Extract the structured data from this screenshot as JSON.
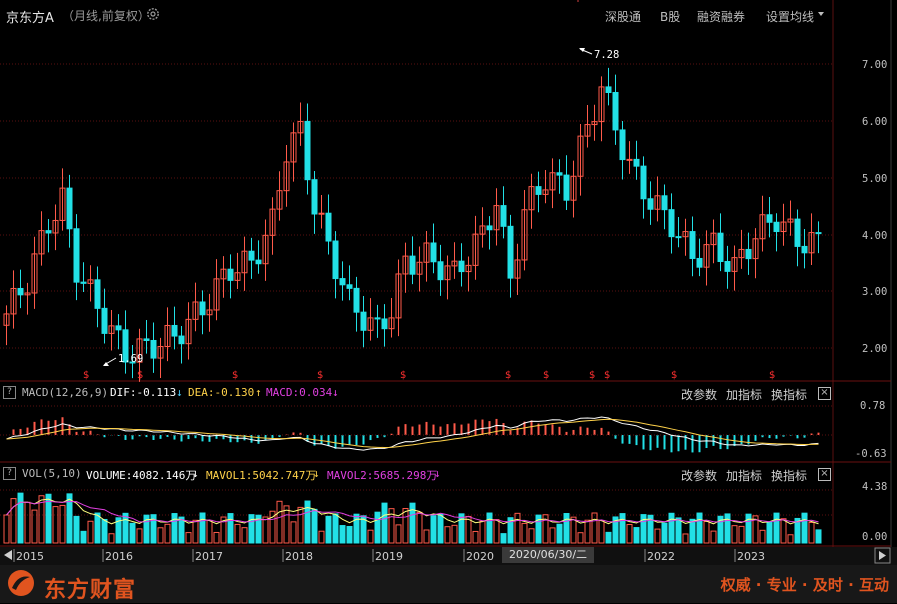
{
  "header": {
    "stock_name": "京东方A",
    "period_label": "（月线,前复权）",
    "nav": [
      "深股通",
      "B股",
      "融资融券",
      "设置均线"
    ]
  },
  "price_axis": [
    "7.00",
    "6.00",
    "5.00",
    "4.00",
    "3.00",
    "2.00"
  ],
  "annotations": {
    "high": "7.28",
    "low": "1.69"
  },
  "macd_panel": {
    "help": "?",
    "title": "MACD(12,26,9)",
    "dif": "DIF:-0.113",
    "dea": "DEA:-0.130",
    "macd": "MACD:0.034",
    "axis_top": "0.78",
    "axis_bottom": "-0.63",
    "controls": [
      "改参数",
      "加指标",
      "换指标"
    ]
  },
  "vol_panel": {
    "help": "?",
    "title": "VOL(5,10)",
    "volume": "VOLUME:4082.146万",
    "mavol1": "MAVOL1:5042.747万",
    "mavol2": "MAVOL2:5685.298万",
    "axis_top": "4.38",
    "axis_bottom": "0.00",
    "controls": [
      "改参数",
      "加指标",
      "换指标"
    ]
  },
  "timeline": {
    "years": [
      "2015",
      "2016",
      "2017",
      "2018",
      "2019",
      "2020",
      "2022",
      "2023"
    ],
    "cursor_date": "2020/06/30/二"
  },
  "footer": {
    "logo": "东方财富",
    "slogan": "权威 · 专业 · 及时 · 互动"
  },
  "colors": {
    "up": "#ff5a4a",
    "down": "#22e0e6",
    "dif": "#ffffff",
    "dea": "#ffd24a",
    "mavol2": "#e040e0",
    "brand": "#e0541f"
  }
}
